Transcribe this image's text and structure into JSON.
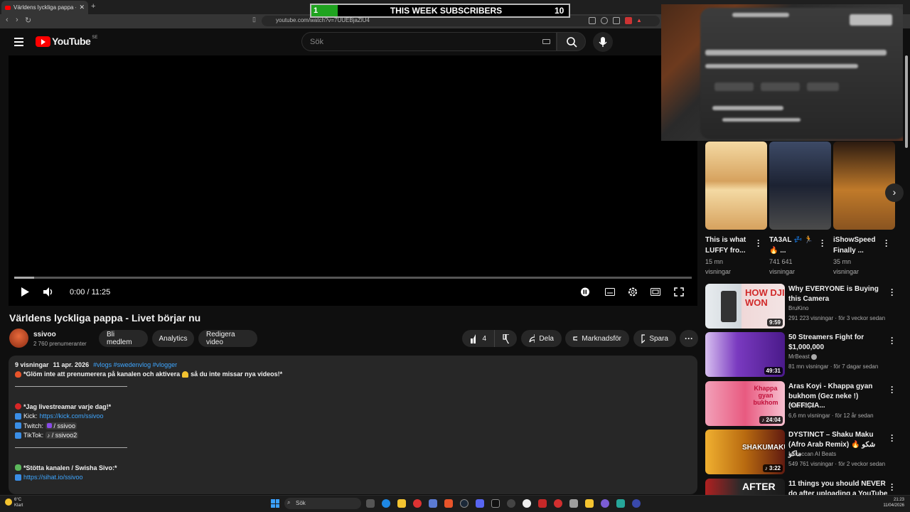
{
  "browser": {
    "tab_title": "Världens lyckliga pappa - Livet b",
    "url": "youtube.com/watch?v=7UUEBjaZlU4"
  },
  "overlay": {
    "current": "1",
    "label": "THIS WEEK SUBSCRIBERS",
    "goal": "10",
    "progress_fraction": 0.1
  },
  "header": {
    "logo_text": "YouTube",
    "region": "SE",
    "search_placeholder": "Sök"
  },
  "player": {
    "time": "0:00 / 11:25"
  },
  "video": {
    "title": "Världens lyckliga pappa - Livet börjar nu",
    "channel": "ssivoo",
    "subscribers": "2 760 prenumeranter",
    "buttons": [
      "Bli medlem",
      "Analytics",
      "Redigera video"
    ],
    "likes": "4",
    "share": "Dela",
    "promote": "Marknadsför",
    "save": "Spara"
  },
  "description": {
    "views": "9 visningar",
    "date": "11 apr. 2026",
    "hashtags": "#vlogs #swedenvlog #vlogger",
    "line1a": "*Glöm inte att prenumerera på kanalen och aktivera",
    "line1b": "så du inte missar nya videos!*",
    "live_heading": "*Jag livestreamar varje dag!*",
    "kick_label": "Kick:",
    "kick_url": "https://kick.com/ssivoo",
    "twitch_label": "Twitch:",
    "twitch_handle": "/ ssivoo",
    "tiktok_label": "TikTok:",
    "tiktok_handle": "/ ssivoo2",
    "support_heading": "*Stötta kanalen / Swisha Sivo:*",
    "support_url": "https://sihat.io/ssivoo"
  },
  "shorts": [
    {
      "title": "This is what LUFFY fro...",
      "views": "15 mn",
      "views2": "visningar"
    },
    {
      "title": "TA3AL 💤 🏃 🔥 ...",
      "views": "741 641",
      "views2": "visningar"
    },
    {
      "title": "iShowSpeed Finally ...",
      "views": "35 mn",
      "views2": "visningar"
    }
  ],
  "recommendations": [
    {
      "title": "Why EVERYONE is Buying this Camera",
      "channel": "BruKino",
      "meta": "291 223 visningar · för 3 veckor sedan",
      "duration": "9:59",
      "color": "#c9d2d8"
    },
    {
      "title": "50 Streamers Fight for $1,000,000",
      "channel": "MrBeast",
      "meta": "81 mn visningar · för 7 dagar sedan",
      "duration": "49:31",
      "color": "#6a3aa6"
    },
    {
      "title": "Aras Koyi - Khappa gyan bukhom (Gez neke !)(OFFICIA...",
      "channel": "Aras Koyi",
      "meta": "6,6 mn visningar · för 12 år sedan",
      "duration": "24:04",
      "color": "#d84a6a"
    },
    {
      "title": "DYSTINCT – Shaku Maku (Afro Arab Remix) 🔥 شكو ماكو",
      "channel": "Moroccan AI Beats",
      "meta": "549 761 visningar · för 2 veckor sedan",
      "duration": "3:22",
      "color": "#b06018"
    },
    {
      "title": "11 things you should NEVER do after uploading a YouTube video",
      "channel": "",
      "meta": "",
      "duration": "",
      "color": "#8a1a1a"
    }
  ],
  "recommendation_overlay_text": [
    "HOW DJI WON",
    "Khappa gyan bukhom",
    "SHAKUMAKU",
    "AFTER"
  ],
  "taskbar": {
    "weather_temp": "6°C",
    "weather_desc": "Klart",
    "search": "Sök",
    "time": "21:23",
    "date": "11/04/2026"
  }
}
